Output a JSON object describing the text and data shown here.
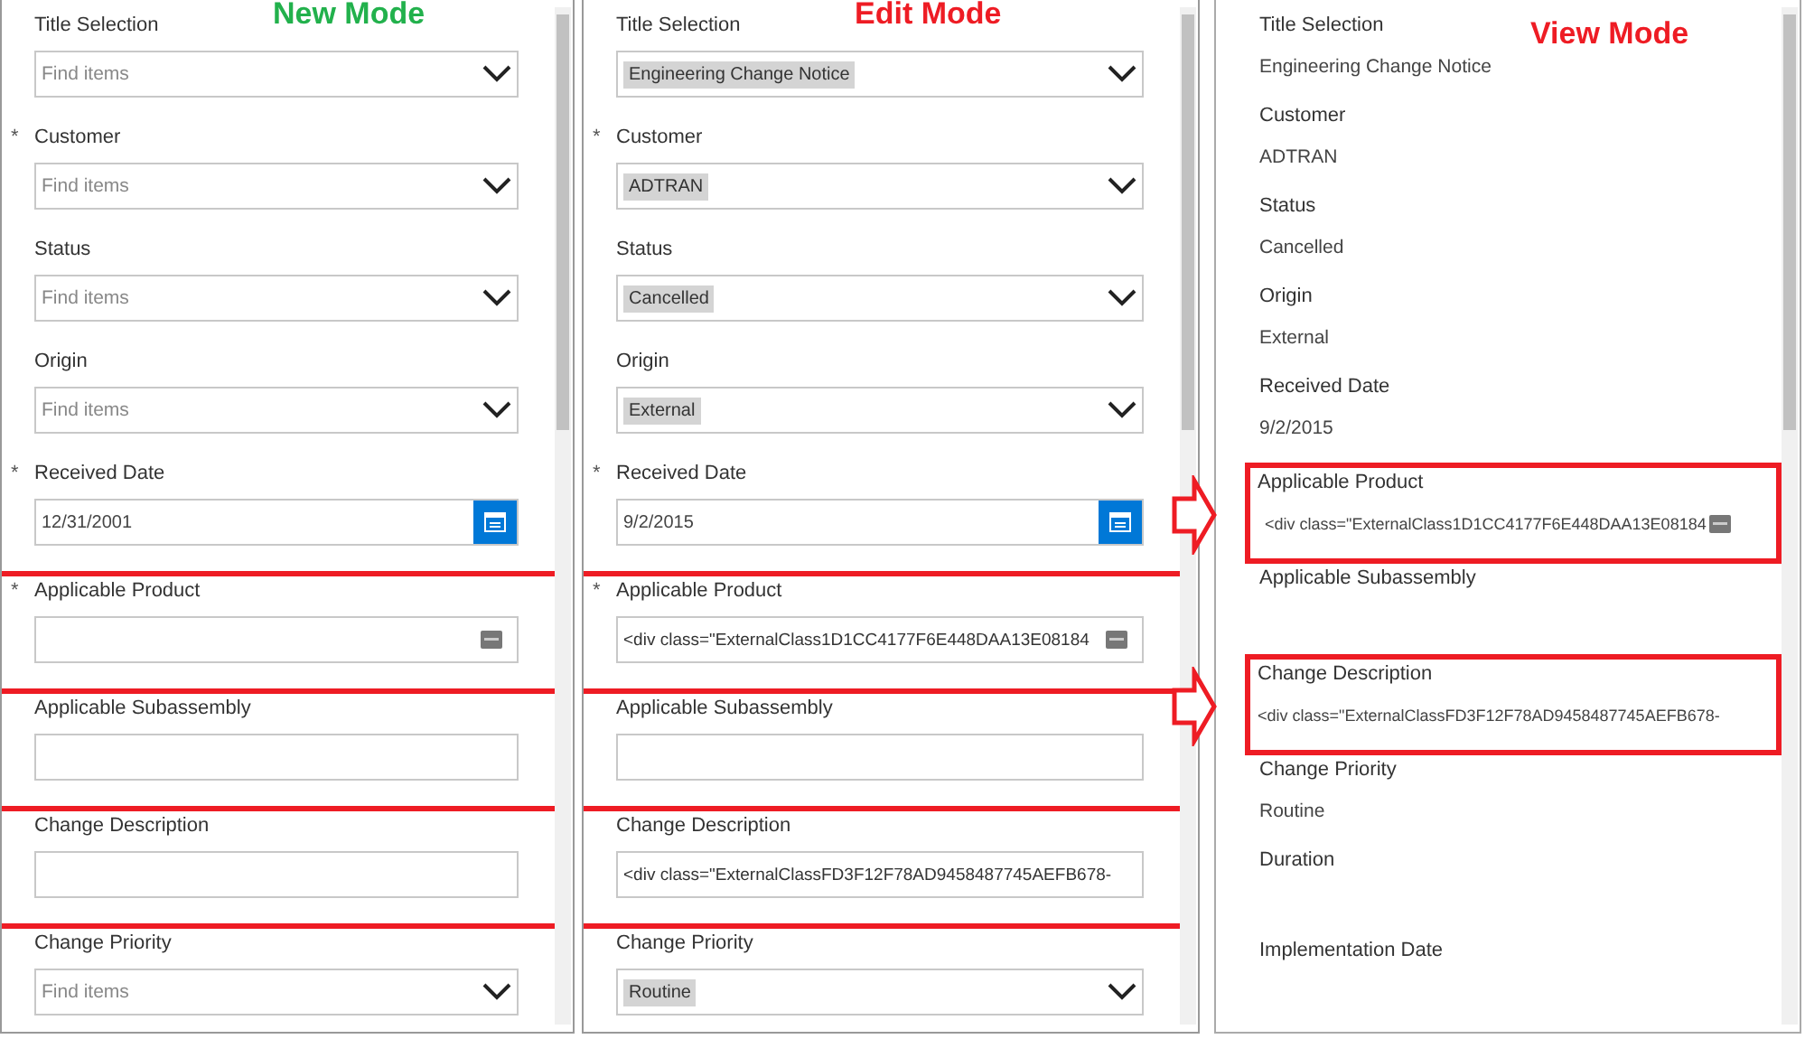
{
  "panels": [
    {
      "title": "New Mode",
      "color": "#22b14c",
      "kind": "form",
      "fields": [
        {
          "label": "Title Selection",
          "kind": "dropdown",
          "placeholder": "Find items",
          "highlighted": false
        },
        {
          "required_mark": "*",
          "label": "Customer",
          "kind": "dropdown",
          "placeholder": "Find items",
          "highlighted": false
        },
        {
          "label": "Status",
          "kind": "dropdown",
          "placeholder": "Find items",
          "highlighted": false
        },
        {
          "label": "Origin",
          "kind": "dropdown",
          "placeholder": "Find items",
          "highlighted": false
        },
        {
          "required_mark": "*",
          "label": "Received Date",
          "kind": "date",
          "value": "12/31/2001",
          "highlighted": false
        },
        {
          "required_mark": "*",
          "label": "Applicable Product",
          "kind": "lookup",
          "highlighted": true
        },
        {
          "label": "Applicable Subassembly",
          "kind": "text",
          "highlighted": false
        },
        {
          "label": "Change Description",
          "kind": "text",
          "highlighted": true
        },
        {
          "label": "Change Priority",
          "kind": "dropdown",
          "placeholder": "Find items",
          "highlighted": false
        }
      ]
    },
    {
      "title": "Edit Mode",
      "color": "#ee1c24",
      "kind": "form",
      "fields": [
        {
          "label": "Title Selection",
          "kind": "dropdown",
          "value": "Engineering Change Notice",
          "highlighted": false
        },
        {
          "required_mark": "*",
          "label": "Customer",
          "kind": "dropdown",
          "value": "ADTRAN",
          "highlighted": false
        },
        {
          "label": "Status",
          "kind": "dropdown",
          "value": "Cancelled",
          "highlighted": false
        },
        {
          "label": "Origin",
          "kind": "dropdown",
          "value": "External",
          "highlighted": false
        },
        {
          "required_mark": "*",
          "label": "Received Date",
          "kind": "date",
          "value": "9/2/2015",
          "highlighted": false
        },
        {
          "required_mark": "*",
          "label": "Applicable Product",
          "kind": "lookup",
          "value": "<div class=\"ExternalClass1D1CC4177F6E448DAA13E08184",
          "highlighted": true
        },
        {
          "label": "Applicable Subassembly",
          "kind": "text",
          "highlighted": false
        },
        {
          "label": "Change Description",
          "kind": "text",
          "value": "<div class=\"ExternalClassFD3F12F78AD9458487745AEFB678-",
          "highlighted": true
        },
        {
          "label": "Change Priority",
          "kind": "dropdown",
          "value": "Routine",
          "highlighted": false
        }
      ]
    },
    {
      "title": "View Mode",
      "color": "#ee1c24",
      "kind": "view",
      "fields": [
        {
          "label": "Title Selection",
          "kind": "display",
          "value": "Engineering Change Notice",
          "highlighted": false
        },
        {
          "label": "Customer",
          "kind": "display",
          "value": "ADTRAN",
          "highlighted": false
        },
        {
          "label": "Status",
          "kind": "display",
          "value": "Cancelled",
          "highlighted": false
        },
        {
          "label": "Origin",
          "kind": "display",
          "value": "External",
          "highlighted": false
        },
        {
          "label": "Received Date",
          "kind": "display",
          "value": "9/2/2015",
          "highlighted": false
        },
        {
          "label": "Applicable Product",
          "kind": "lookup",
          "value": "<div class=\"ExternalClass1D1CC4177F6E448DAA13E08184",
          "highlighted": true
        },
        {
          "label": "Applicable Subassembly",
          "kind": "display",
          "highlighted": false
        },
        {
          "label": "Change Description",
          "kind": "display",
          "value": "<div class=\"ExternalClassFD3F12F78AD9458487745AEFB678-",
          "highlighted": true
        },
        {
          "label": "Change Priority",
          "kind": "display",
          "value": "Routine",
          "highlighted": false
        },
        {
          "label": "Duration",
          "kind": "display",
          "highlighted": false
        },
        {
          "label": "Implementation Date",
          "kind": "display",
          "highlighted": false
        }
      ]
    }
  ]
}
